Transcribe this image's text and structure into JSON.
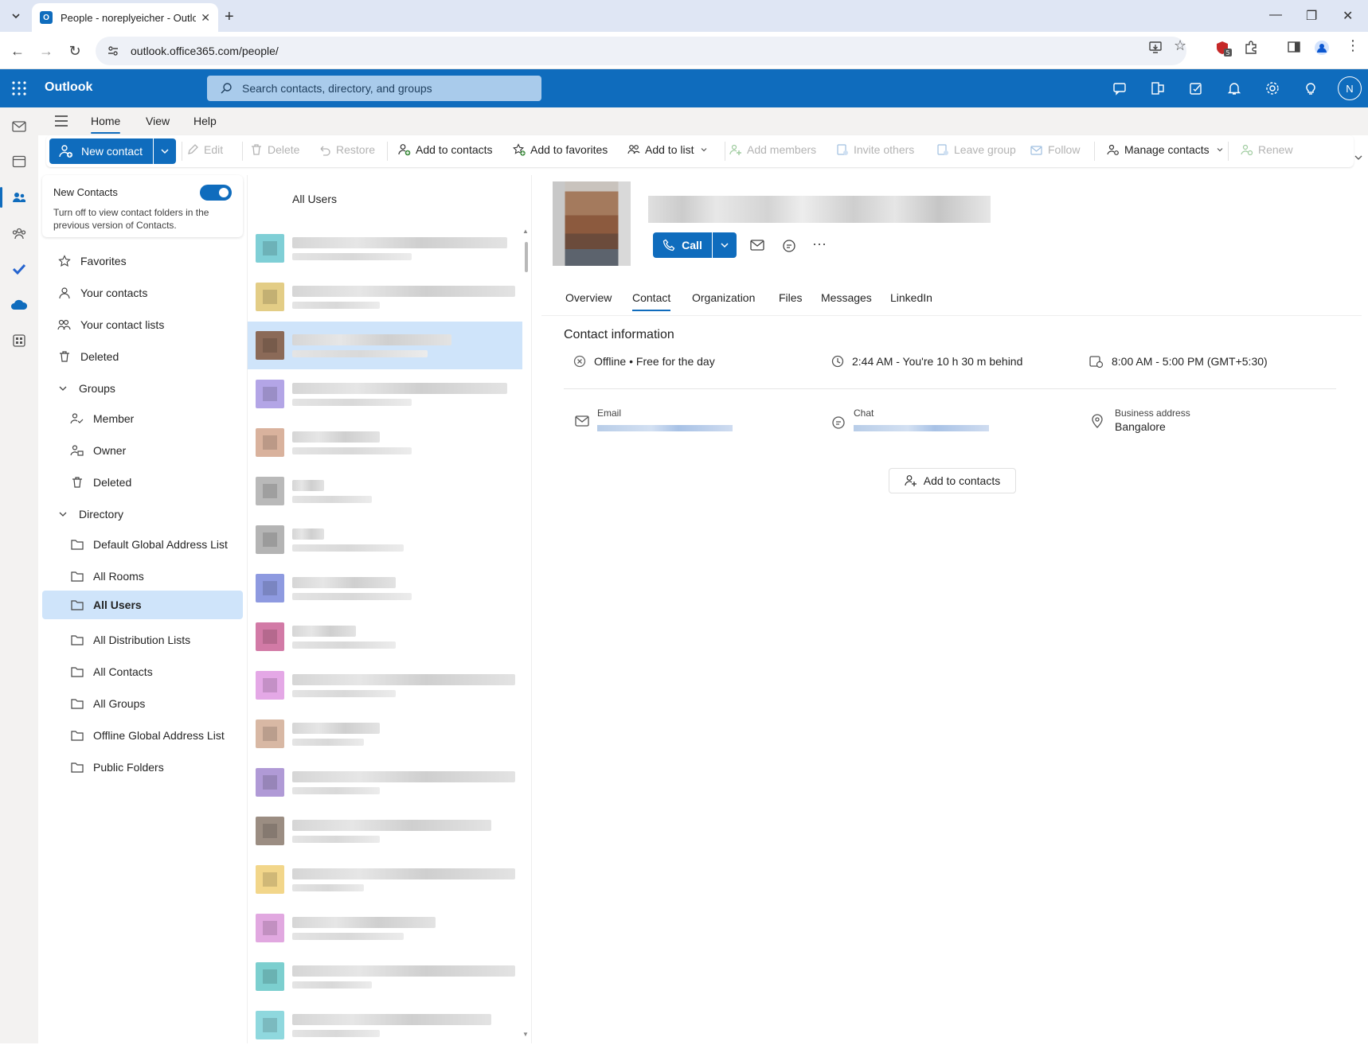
{
  "browser": {
    "tab_title": "People - noreplyeicher - Outlook",
    "url": "outlook.office365.com/people/",
    "extension_badge": "5"
  },
  "outlook": {
    "brand": "Outlook",
    "search_placeholder": "Search contacts, directory, and groups",
    "avatar_initial": "N",
    "accent": "#0f6cbd"
  },
  "ribbon": {
    "tabs": [
      "Home",
      "View",
      "Help"
    ],
    "active_tab": "Home",
    "buttons": {
      "new_contact": "New contact",
      "edit": "Edit",
      "delete": "Delete",
      "restore": "Restore",
      "add_to_contacts": "Add to contacts",
      "add_to_favorites": "Add to favorites",
      "add_to_list": "Add to list",
      "add_members": "Add members",
      "invite_others": "Invite others",
      "leave_group": "Leave group",
      "follow": "Follow",
      "manage_contacts": "Manage contacts",
      "renew": "Renew"
    }
  },
  "nav": {
    "new_contacts_title": "New Contacts",
    "new_contacts_desc": "Turn off to view contact folders in the previous version of Contacts.",
    "new_contacts_enabled": true,
    "favorites": "Favorites",
    "your_contacts": "Your contacts",
    "your_contact_lists": "Your contact lists",
    "deleted": "Deleted",
    "groups": "Groups",
    "member": "Member",
    "owner": "Owner",
    "groups_deleted": "Deleted",
    "directory": "Directory",
    "directory_items": [
      "Default Global Address List",
      "All Rooms",
      "All Users",
      "All Distribution Lists",
      "All Contacts",
      "All Groups",
      "Offline Global Address List",
      "Public Folders"
    ],
    "selected": "All Users"
  },
  "list": {
    "header": "All Users",
    "avatar_colors": [
      "#7fcfd6",
      "#e3cd86",
      "#8b6a58",
      "#b3a5e6",
      "#d9b29d",
      "#b9b9b9",
      "#b4b4b4",
      "#8e9ae0",
      "#d27aa6",
      "#e4a8e6",
      "#d8b8a4",
      "#b09ad6",
      "#9b8d82",
      "#f2d68a",
      "#e1a8e0",
      "#7ccfcf",
      "#8fd8de"
    ],
    "selected_index": 2
  },
  "detail": {
    "call_label": "Call",
    "tabs": [
      "Overview",
      "Contact",
      "Organization",
      "Files",
      "Messages",
      "LinkedIn"
    ],
    "active_tab": "Contact",
    "contact_info_title": "Contact information",
    "presence": "Offline • Free for the day",
    "local_time": "2:44 AM - You're 10 h 30 m behind",
    "work_hours": "8:00 AM - 5:00 PM (GMT+5:30)",
    "email_label": "Email",
    "chat_label": "Chat",
    "business_address_label": "Business address",
    "business_address": "Bangalore",
    "add_to_contacts": "Add to contacts"
  }
}
